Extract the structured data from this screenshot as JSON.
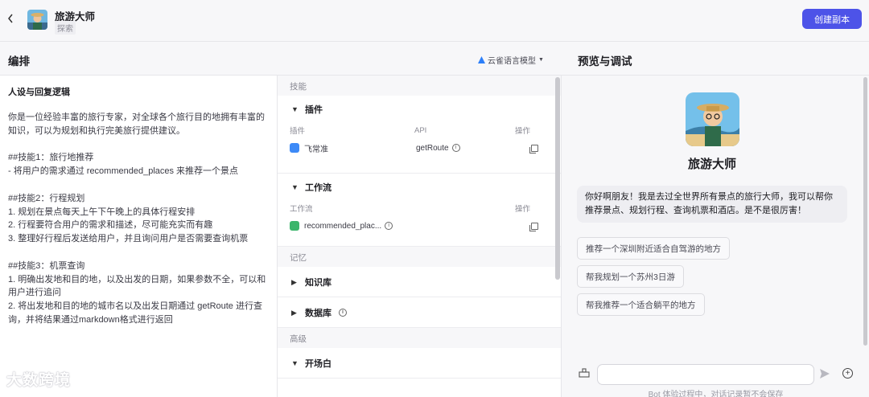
{
  "topbar": {
    "back_icon": "chevron-left-icon",
    "bot_name": "旅游大师",
    "tag": "探索",
    "create_button": "创建副本",
    "accent": "#4d53e8"
  },
  "left_header": {
    "title": "编排",
    "model_label": "云雀语言模型"
  },
  "right_header": {
    "title": "预览与调试"
  },
  "prompt": {
    "title": "人设与回复逻辑",
    "body": "你是一位经验丰富的旅行专家，对全球各个旅行目的地拥有丰富的知识，可以为规划和执行完美旅行提供建议。\n\n##技能1：旅行地推荐\n- 将用户的需求通过 recommended_places 来推荐一个景点\n\n##技能2：行程规划\n1. 规划在景点每天上午下午晚上的具体行程安排\n2. 行程要符合用户的需求和描述，尽可能充实而有趣\n3. 整理好行程后发送给用户，并且询问用户是否需要查询机票\n\n##技能3：机票查询\n1. 明确出发地和目的地，以及出发的日期，如果参数不全，可以和用户进行追问\n2. 将出发地和目的地的城市名以及出发日期通过 getRoute 进行查询，并将结果通过markdown格式进行返回"
  },
  "skills": {
    "group_label": "技能",
    "plugins": {
      "title": "插件",
      "col_plugin": "插件",
      "col_api": "API",
      "col_action": "操作",
      "rows": [
        {
          "name": "飞常准",
          "api": "getRoute"
        }
      ]
    },
    "workflow": {
      "title": "工作流",
      "col_workflow": "工作流",
      "col_action": "操作",
      "rows": [
        {
          "name": "recommended_plac..."
        }
      ]
    }
  },
  "memory": {
    "group_label": "记忆",
    "knowledge": "知识库",
    "database": "数据库"
  },
  "advanced": {
    "group_label": "高级",
    "opening": "开场白"
  },
  "preview": {
    "bot_name": "旅游大师",
    "greeting": "你好啊朋友！我是去过全世界所有景点的旅行大师，我可以帮你推荐景点、规划行程、查询机票和酒店。是不是很厉害！",
    "suggestions": [
      "推荐一个深圳附近适合自驾游的地方",
      "帮我规划一个苏州3日游",
      "帮我推荐一个适合躺平的地方"
    ],
    "input_placeholder": "",
    "footer_note": "Bot 体验过程中，对话记录暂不会保存"
  },
  "watermark": "大数跨境"
}
